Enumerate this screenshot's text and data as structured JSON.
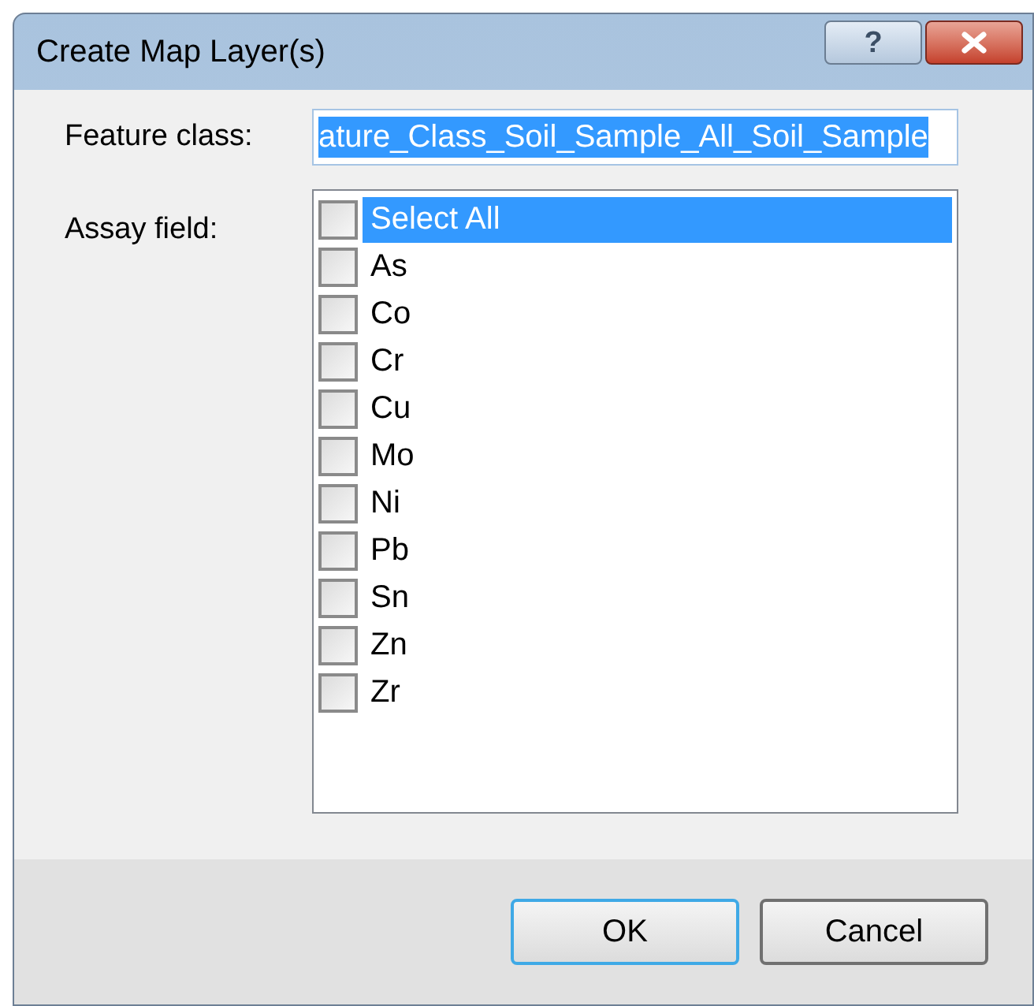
{
  "window": {
    "title": "Create Map Layer(s)",
    "help_button": "?"
  },
  "feature_class": {
    "label": "Feature class:",
    "value": "ature_Class_Soil_Sample_All_Soil_Sample",
    "text_selected": true
  },
  "assay_field": {
    "label": "Assay field:",
    "items": [
      {
        "label": "Select All",
        "checked": false,
        "selected": true
      },
      {
        "label": "As",
        "checked": false,
        "selected": false
      },
      {
        "label": "Co",
        "checked": false,
        "selected": false
      },
      {
        "label": "Cr",
        "checked": false,
        "selected": false
      },
      {
        "label": "Cu",
        "checked": false,
        "selected": false
      },
      {
        "label": "Mo",
        "checked": false,
        "selected": false
      },
      {
        "label": "Ni",
        "checked": false,
        "selected": false
      },
      {
        "label": "Pb",
        "checked": false,
        "selected": false
      },
      {
        "label": "Sn",
        "checked": false,
        "selected": false
      },
      {
        "label": "Zn",
        "checked": false,
        "selected": false
      },
      {
        "label": "Zr",
        "checked": false,
        "selected": false
      }
    ]
  },
  "buttons": [
    {
      "label": "OK",
      "default": true
    },
    {
      "label": "Cancel",
      "default": false
    }
  ]
}
